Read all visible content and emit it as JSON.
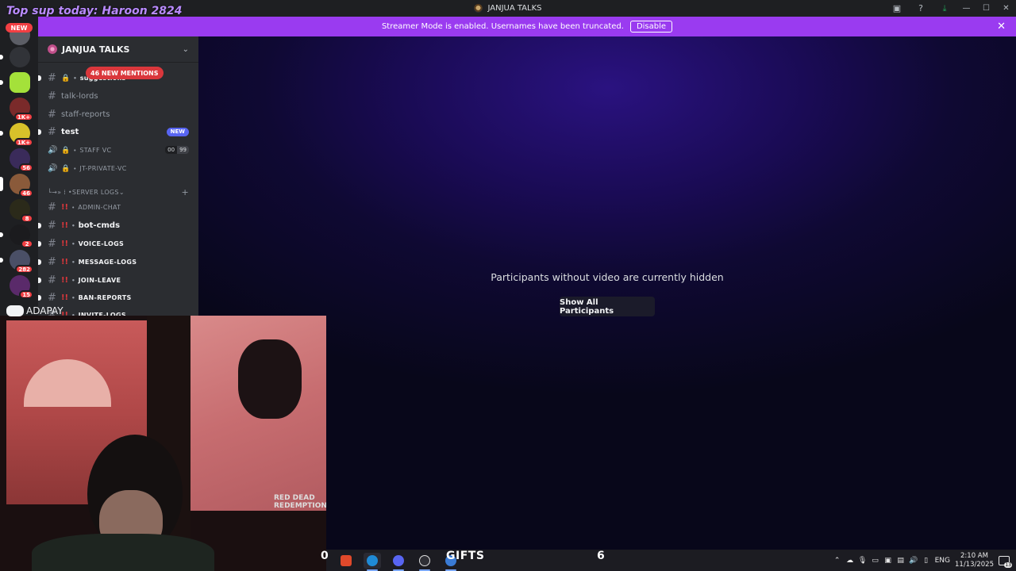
{
  "overlay": {
    "top_text": "Top sup today: Haroon 2824",
    "adapay": "ADAPAY"
  },
  "window": {
    "title": "JANJUA TALKS"
  },
  "banner": {
    "text": "Streamer Mode is enabled. Usernames have been truncated.",
    "button": "Disable"
  },
  "rail": {
    "new_label": "NEW",
    "badges": [
      "1K+",
      "1K+",
      "56",
      "46",
      "8",
      "2",
      "282",
      "15"
    ]
  },
  "guild": {
    "name": "JANJUA TALKS",
    "mentions": "46 NEW MENTIONS"
  },
  "channels": {
    "suggestions": "suggestions",
    "talk_lords": "talk-lords",
    "staff_reports": "staff-reports",
    "test": "test",
    "test_tag": "NEW",
    "staff_vc": "STAFF VC",
    "staff_vc_count_a": "00",
    "staff_vc_count_b": "99",
    "jt_private_vc": "JT-PRIVATE-VC",
    "category_server_logs": "SERVER LOGS",
    "admin_chat": "ADMIN-CHAT",
    "bot_cmds": "bot-cmds",
    "voice_logs": "VOICE-LOGS",
    "message_logs": "MESSAGE-LOGS",
    "join_leave": "JOIN-LEAVE",
    "ban_reports": "BAN-REPORTS",
    "invite_logs": "INVITE-LOGS"
  },
  "stage": {
    "message": "Participants without video are currently hidden",
    "button": "Show All Participants"
  },
  "cam": {
    "poster_text": "RED DEAD REDEMPTION"
  },
  "taskbar": {
    "zero": "0",
    "gifts_label": "GIFTS",
    "gifts_count": "6",
    "lang": "ENG",
    "time": "2:10 AM",
    "date": "11/13/2025",
    "notif_count": "13"
  },
  "colors": {
    "accent": "#9a3bf0",
    "mention_red": "#da373c",
    "blurple": "#5865f2"
  }
}
